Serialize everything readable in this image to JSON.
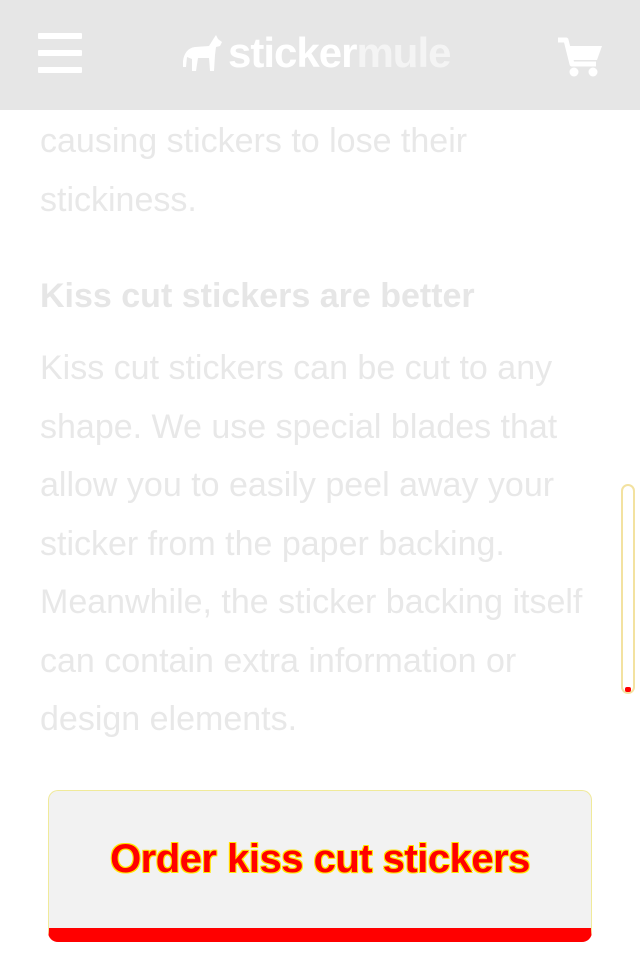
{
  "header": {
    "logo_text_1": "sticker",
    "logo_text_2": "mule",
    "menu_icon": "hamburger-menu-icon",
    "cart_icon": "shopping-cart-icon",
    "background": "#e6e6e6"
  },
  "content": {
    "intro_paragraph": "causing stickers to lose their stickiness.",
    "heading": "Kiss cut stickers are better",
    "body_paragraph": "Kiss cut stickers can be cut to any shape. We use special blades that allow you to easily peel away your sticker from the paper backing. Meanwhile, the sticker backing itself can contain extra information or design elements."
  },
  "cta": {
    "label": "Order kiss cut stickers",
    "accent": "#ff0000"
  }
}
